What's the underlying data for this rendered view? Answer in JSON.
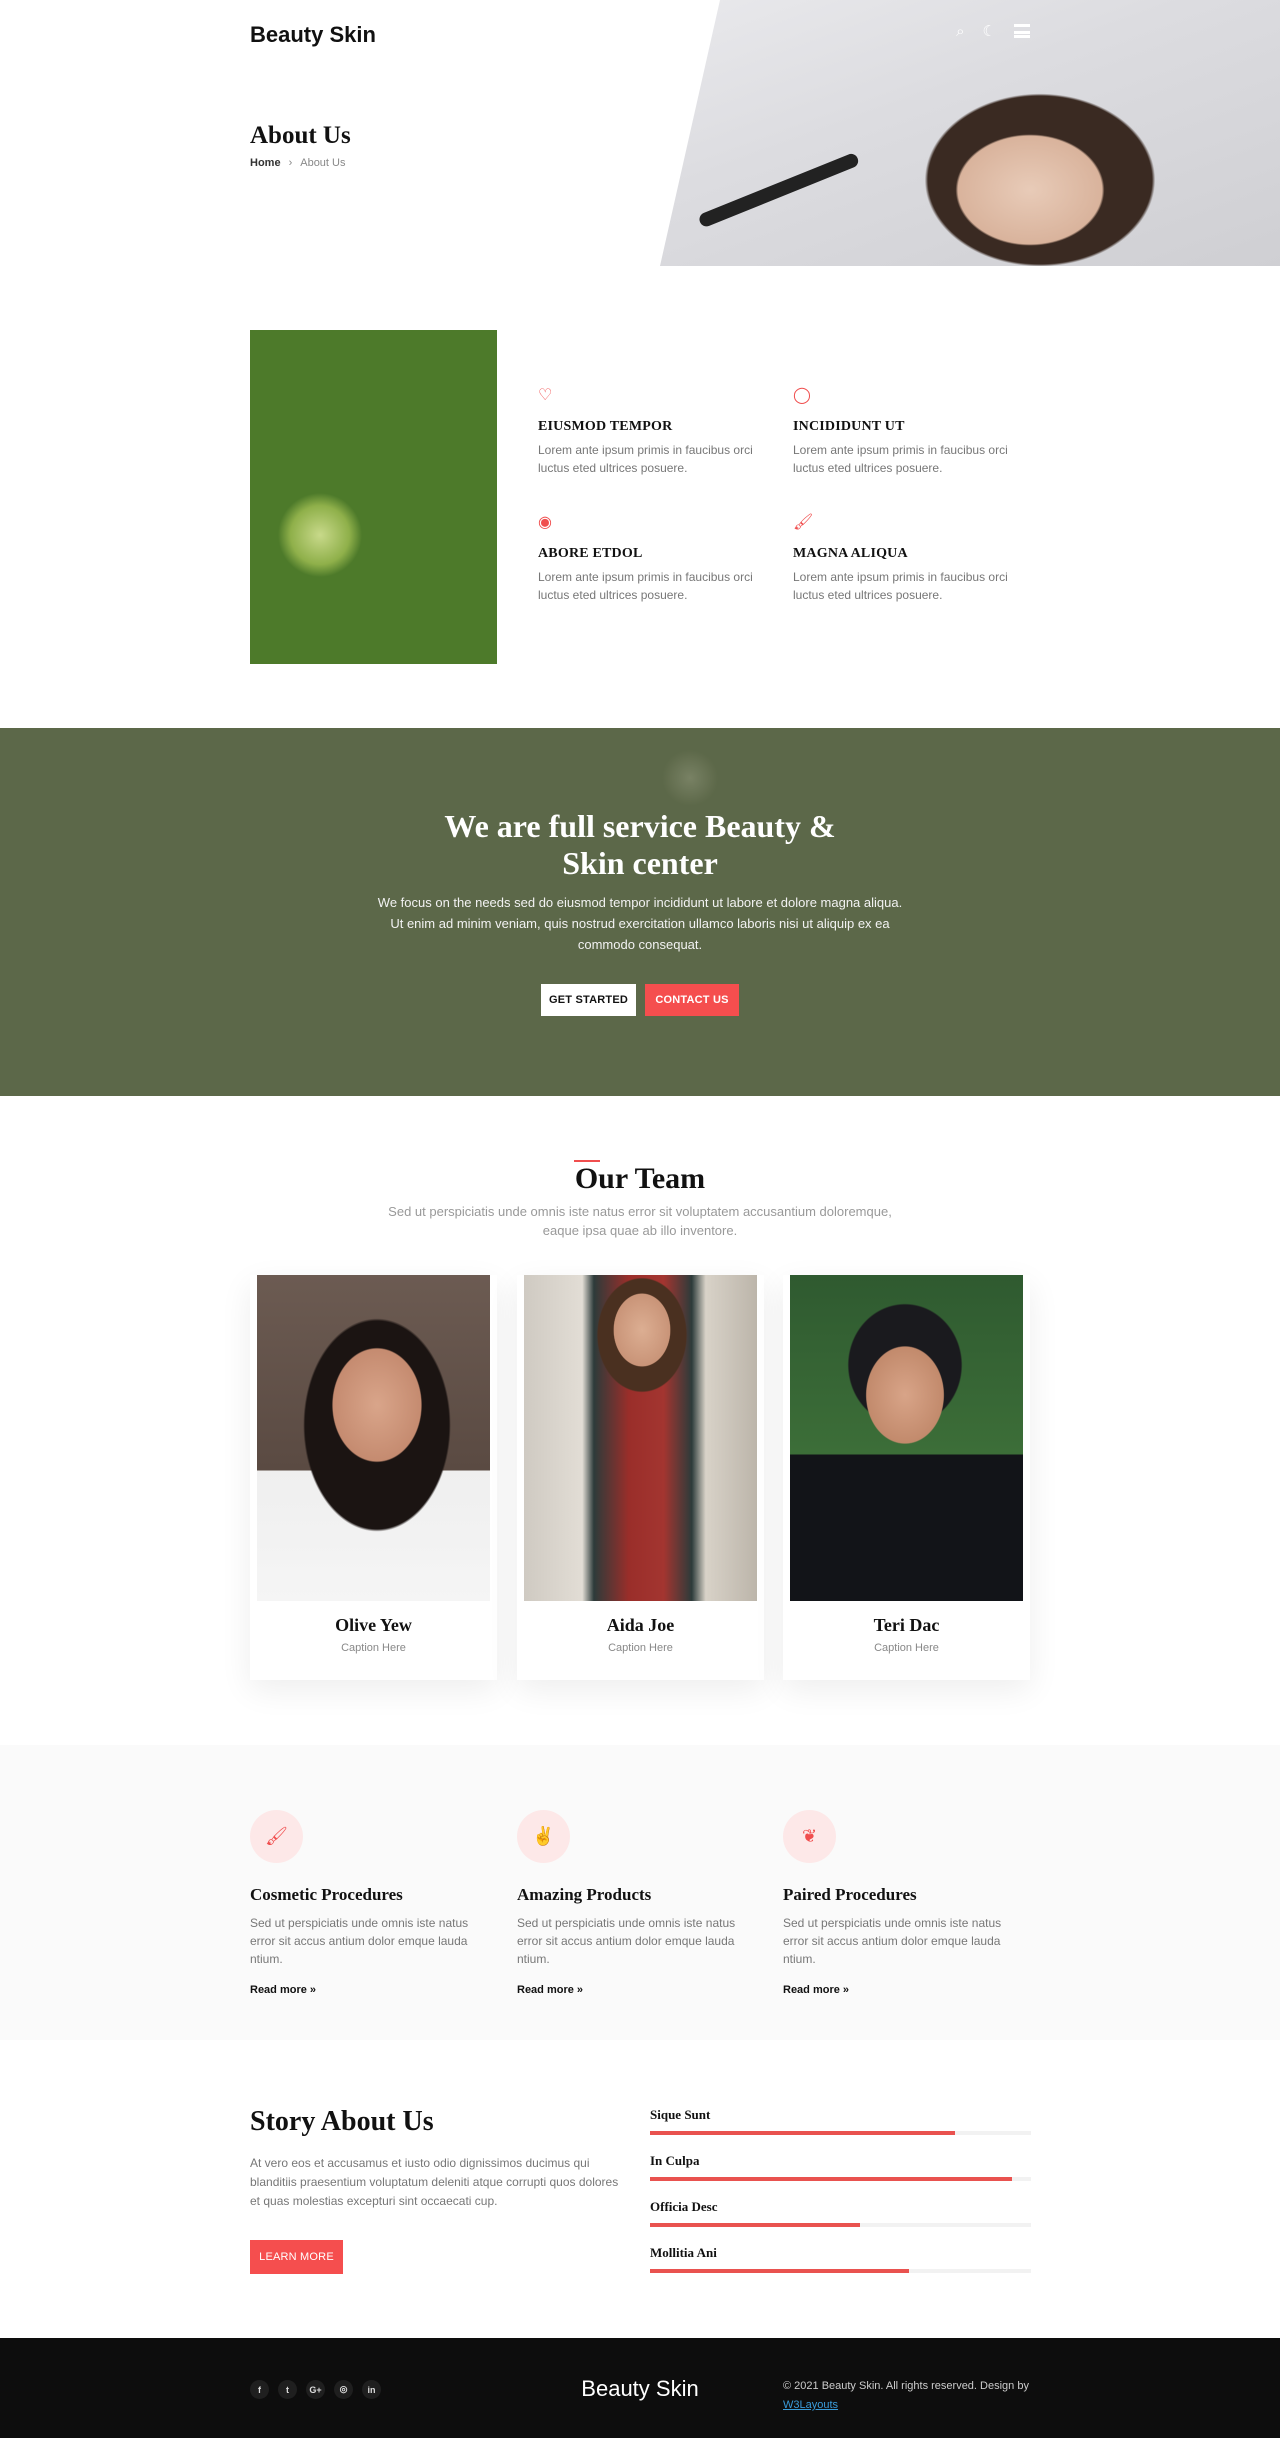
{
  "header": {
    "logo": "Beauty Skin",
    "icons": [
      "search-icon",
      "moon-icon",
      "menu-icon"
    ]
  },
  "hero": {
    "title": "About Us",
    "breadcrumb": {
      "home": "Home",
      "separator": "›",
      "current": "About Us"
    }
  },
  "features": [
    {
      "icon": "heart-icon",
      "glyph": "♡",
      "title": "EIUSMOD TEMPOR",
      "text": "Lorem ante ipsum primis in faucibus orci luctus eted ultrices posuere."
    },
    {
      "icon": "circle-icon",
      "glyph": "◯",
      "title": "INCIDIDUNT UT",
      "text": "Lorem ante ipsum primis in faucibus orci luctus eted ultrices posuere."
    },
    {
      "icon": "eye-icon",
      "glyph": "◉",
      "title": "ABORE ETDOL",
      "text": "Lorem ante ipsum primis in faucibus orci luctus eted ultrices posuere."
    },
    {
      "icon": "brush-icon",
      "glyph": "🖌",
      "title": "MAGNA ALIQUA",
      "text": "Lorem ante ipsum primis in faucibus orci luctus eted ultrices posuere."
    }
  ],
  "banner": {
    "title_line1": "We are full service Beauty &",
    "title_line2": "Skin center",
    "text": "We focus on the needs sed do eiusmod tempor incididunt ut labore et dolore magna aliqua. Ut enim ad minim veniam, quis nostrud exercitation ullamco laboris nisi ut aliquip ex ea commodo consequat.",
    "get_started": "GET STARTED",
    "contact_us": "CONTACT US"
  },
  "team": {
    "title": "Our Team",
    "subtitle": "Sed ut perspiciatis unde omnis iste natus error sit voluptatem accusantium doloremque, eaque ipsa quae ab illo inventore.",
    "members": [
      {
        "name": "Olive Yew",
        "caption": "Caption Here"
      },
      {
        "name": "Aida Joe",
        "caption": "Caption Here"
      },
      {
        "name": "Teri Dac",
        "caption": "Caption Here"
      }
    ]
  },
  "services": [
    {
      "icon": "brush-icon",
      "glyph": "🖌",
      "title": "Cosmetic Procedures",
      "text": "Sed ut perspiciatis unde omnis iste natus error sit accus antium dolor emque lauda ntium.",
      "link": "Read more »"
    },
    {
      "icon": "peace-hand-icon",
      "glyph": "✌",
      "title": "Amazing Products",
      "text": "Sed ut perspiciatis unde omnis iste natus error sit accus antium dolor emque lauda ntium.",
      "link": "Read more »"
    },
    {
      "icon": "leaf-icon",
      "glyph": "❦",
      "title": "Paired Procedures",
      "text": "Sed ut perspiciatis unde omnis iste natus error sit accus antium dolor emque lauda ntium.",
      "link": "Read more »"
    }
  ],
  "story": {
    "title": "Story About Us",
    "text": "At vero eos et accusamus et iusto odio dignissimos ducimus qui blanditiis praesentium voluptatum deleniti atque corrupti quos dolores et quas molestias excepturi sint occaecati cup.",
    "button": "LEARN MORE",
    "skills": [
      {
        "label": "Sique Sunt",
        "percent": 80
      },
      {
        "label": "In Culpa",
        "percent": 95
      },
      {
        "label": "Officia Desc",
        "percent": 55
      },
      {
        "label": "Mollitia Ani",
        "percent": 68
      }
    ]
  },
  "footer": {
    "social": [
      {
        "icon": "facebook-icon",
        "glyph": "f"
      },
      {
        "icon": "twitter-icon",
        "glyph": "t"
      },
      {
        "icon": "google-plus-icon",
        "glyph": "G+"
      },
      {
        "icon": "instagram-icon",
        "glyph": "◎"
      },
      {
        "icon": "linkedin-icon",
        "glyph": "in"
      }
    ],
    "logo": "Beauty Skin",
    "copyright": "© 2021 Beauty Skin. All rights reserved. Design by",
    "designer": "W3Layouts"
  },
  "colors": {
    "accent": "#f54e4e",
    "footer_bg": "#0d0d0d",
    "services_bg": "#fafafa"
  }
}
